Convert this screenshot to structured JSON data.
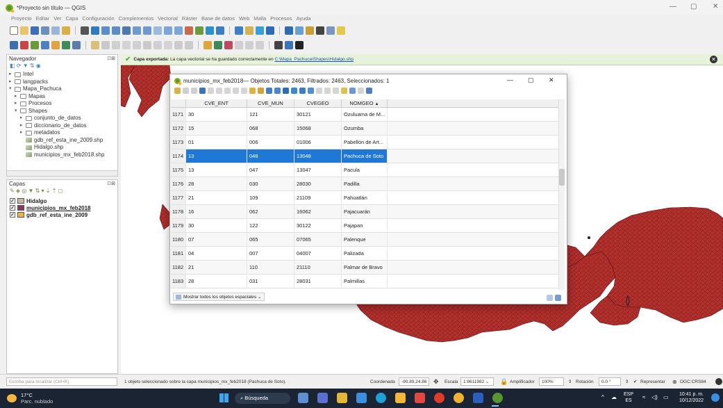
{
  "window": {
    "title": "*Proyecto sin título — QGIS"
  },
  "menu": [
    "Proyecto",
    "Editar",
    "Ver",
    "Capa",
    "Configuración",
    "Complementos",
    "Vectorial",
    "Ráster",
    "Base de datos",
    "Web",
    "Malla",
    "Procesos",
    "Ayuda"
  ],
  "navigator": {
    "title": "Navegador",
    "items": [
      {
        "label": "Intel",
        "indent": 0,
        "arrow": "▸",
        "icon": "folder"
      },
      {
        "label": "langpacks",
        "indent": 0,
        "arrow": "▸",
        "icon": "folder"
      },
      {
        "label": "Mapa_Pachuca",
        "indent": 0,
        "arrow": "▾",
        "icon": "folder"
      },
      {
        "label": "Mapas",
        "indent": 1,
        "arrow": "▸",
        "icon": "folder"
      },
      {
        "label": "Procesos",
        "indent": 1,
        "arrow": "▸",
        "icon": "folder"
      },
      {
        "label": "Shapes",
        "indent": 1,
        "arrow": "▾",
        "icon": "folder"
      },
      {
        "label": "conjunto_de_datos",
        "indent": 2,
        "arrow": "▸",
        "icon": "folder"
      },
      {
        "label": "diccionario_de_datos",
        "indent": 2,
        "arrow": "▸",
        "icon": "folder"
      },
      {
        "label": "metadatos",
        "indent": 2,
        "arrow": "▸",
        "icon": "folder"
      },
      {
        "label": "gdb_ref_esta_ine_2009.shp",
        "indent": 2,
        "arrow": "",
        "icon": "shp"
      },
      {
        "label": "Hidalgo.shp",
        "indent": 2,
        "arrow": "",
        "icon": "shp"
      },
      {
        "label": "municipios_mx_feb2018.shp",
        "indent": 2,
        "arrow": "",
        "icon": "shp"
      }
    ]
  },
  "layers": {
    "title": "Capas",
    "items": [
      {
        "label": "Hidalgo",
        "color": "#c9b8a0",
        "underline": false
      },
      {
        "label": "municipios_mx_feb2018",
        "color": "#8a3a55",
        "underline": true
      },
      {
        "label": "gdb_ref_esta_ine_2009",
        "color": "#e8b44a",
        "underline": false
      }
    ]
  },
  "message": {
    "strong": "Capa exportada:",
    "text": "La capa vectorial se ha guardado correctamente en",
    "link": "C:\\Mapa_Pachuca\\Shapes\\Hidalgo.shp"
  },
  "attribute_table": {
    "title": "municipios_mx_feb2018— Objetos Totales: 2463, Filtrados: 2463, Seleccionados: 1",
    "columns": [
      "CVE_ENT",
      "CVE_MUN",
      "CVEGEO",
      "NOMGEO"
    ],
    "rows": [
      {
        "n": "1171",
        "ent": "30",
        "mun": "121",
        "geo": "30121",
        "nom": "Ozuluama de M..."
      },
      {
        "n": "1172",
        "ent": "15",
        "mun": "068",
        "geo": "15068",
        "nom": "Ozumba"
      },
      {
        "n": "1173",
        "ent": "01",
        "mun": "006",
        "geo": "01006",
        "nom": "Pabellón de Art..."
      },
      {
        "n": "1174",
        "ent": "13",
        "mun": "048",
        "geo": "13048",
        "nom": "Pachuca de Soto",
        "selected": true
      },
      {
        "n": "1175",
        "ent": "13",
        "mun": "047",
        "geo": "13047",
        "nom": "Pacula"
      },
      {
        "n": "1176",
        "ent": "28",
        "mun": "030",
        "geo": "28030",
        "nom": "Padilla"
      },
      {
        "n": "1177",
        "ent": "21",
        "mun": "109",
        "geo": "21109",
        "nom": "Pahuatlán"
      },
      {
        "n": "1178",
        "ent": "16",
        "mun": "062",
        "geo": "16062",
        "nom": "Pajacuarán"
      },
      {
        "n": "1179",
        "ent": "30",
        "mun": "122",
        "geo": "30122",
        "nom": "Pajapan"
      },
      {
        "n": "1180",
        "ent": "07",
        "mun": "065",
        "geo": "07065",
        "nom": "Palenque"
      },
      {
        "n": "1181",
        "ent": "04",
        "mun": "007",
        "geo": "04007",
        "nom": "Palizada"
      },
      {
        "n": "1182",
        "ent": "21",
        "mun": "110",
        "geo": "21110",
        "nom": "Palmar de Bravo"
      },
      {
        "n": "1183",
        "ent": "28",
        "mun": "031",
        "geo": "28031",
        "nom": "Palmillas"
      }
    ],
    "footer_button": "Mostrar todos los objetos espaciales"
  },
  "statusbar": {
    "locator_placeholder": "Escriba para localizar (Ctrl+K)",
    "message": "1 objeto seleccionado sobre la capa municipios_mx_feb2018 (Pachuca de Soto).",
    "coord_label": "Coordenada",
    "coord_value": "-90.89,24.86",
    "scale_label": "Escala",
    "scale_value": "1:8611982",
    "magnifier_label": "Amplificador",
    "magnifier_value": "100%",
    "rotation_label": "Rotación",
    "rotation_value": "0.0 °",
    "render_label": "Representar",
    "crs": "OGC:CRS84"
  },
  "taskbar": {
    "temp": "17°C",
    "weather": "Parc. nublado",
    "search": "Búsqueda",
    "lang1": "ESP",
    "lang2": "ES",
    "time": "10:41 p. m.",
    "date": "10/12/2022"
  },
  "colors": {
    "map_fill": "#b5312e",
    "selection": "#1f78d6",
    "ok_green": "#4a9a2a"
  }
}
